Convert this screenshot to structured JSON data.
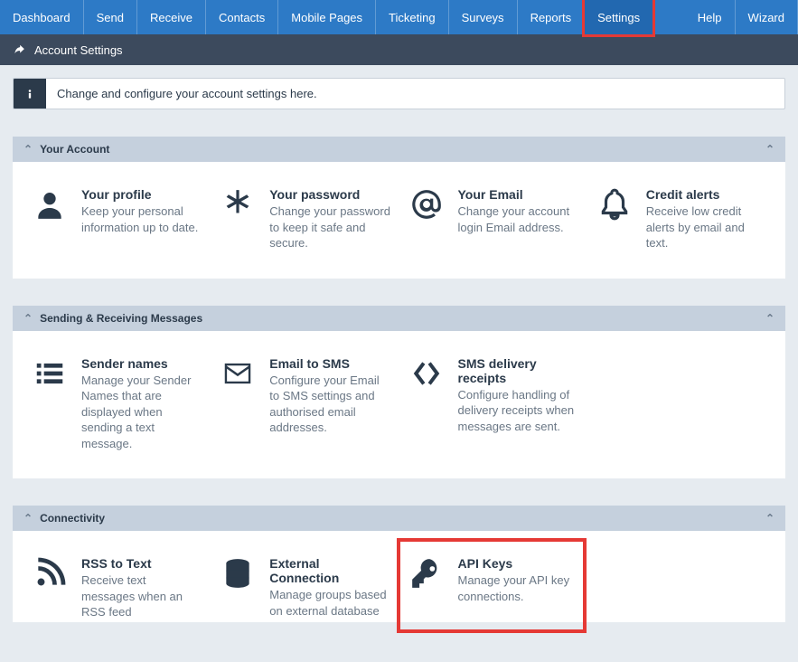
{
  "nav": {
    "items": [
      {
        "label": "Dashboard"
      },
      {
        "label": "Send"
      },
      {
        "label": "Receive"
      },
      {
        "label": "Contacts"
      },
      {
        "label": "Mobile Pages"
      },
      {
        "label": "Ticketing"
      },
      {
        "label": "Surveys"
      },
      {
        "label": "Reports"
      },
      {
        "label": "Settings",
        "active": true,
        "highlight": true
      }
    ],
    "right": [
      {
        "label": "Help"
      },
      {
        "label": "Wizard"
      }
    ]
  },
  "subbar": {
    "title": "Account Settings"
  },
  "info": {
    "text": "Change and configure your account settings here."
  },
  "sections": {
    "account": {
      "title": "Your Account",
      "tiles": [
        {
          "title": "Your profile",
          "desc": "Keep your personal information up to date."
        },
        {
          "title": "Your password",
          "desc": "Change your password to keep it safe and secure."
        },
        {
          "title": "Your Email",
          "desc": "Change your account login Email address."
        },
        {
          "title": "Credit alerts",
          "desc": "Receive low credit alerts by email and text."
        }
      ]
    },
    "messaging": {
      "title": "Sending & Receiving Messages",
      "tiles": [
        {
          "title": "Sender names",
          "desc": "Manage your Sender Names that are displayed when sending a text message."
        },
        {
          "title": "Email to SMS",
          "desc": "Configure your Email to SMS settings and authorised email addresses."
        },
        {
          "title": "SMS delivery receipts",
          "desc": "Configure handling of delivery receipts when messages are sent."
        }
      ]
    },
    "connectivity": {
      "title": "Connectivity",
      "tiles": [
        {
          "title": "RSS to Text",
          "desc": "Receive text messages when an RSS feed"
        },
        {
          "title": "External Connection",
          "desc": "Manage groups based on external database"
        },
        {
          "title": "API Keys",
          "desc": "Manage your API key connections.",
          "highlight": true
        }
      ]
    }
  }
}
